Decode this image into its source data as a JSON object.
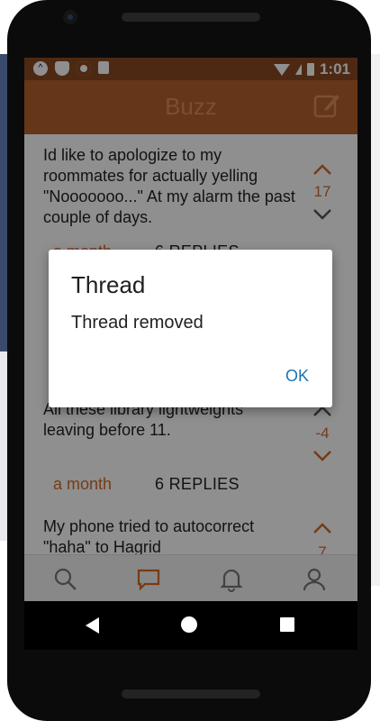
{
  "status_bar": {
    "time": "1:01",
    "icons": [
      "app-notification-icon",
      "shield-icon",
      "record-icon",
      "sd-card-icon",
      "wifi-icon",
      "signal-icon",
      "battery-icon"
    ]
  },
  "app_bar": {
    "title": "Buzz",
    "compose_icon": "compose-icon"
  },
  "posts": [
    {
      "text": "Id like to apologize to my roommates for actually yelling \"Nooooooo...\" At my alarm the past couple of days.",
      "votes": "17",
      "age": "a month",
      "replies": "6 REPLIES"
    },
    {
      "text": "All these library lightweights leaving before 11.",
      "votes": "-4",
      "age": "a month",
      "replies": "6 REPLIES"
    },
    {
      "text": "My phone tried to autocorrect \"haha\" to Hagrid",
      "votes": "7"
    }
  ],
  "bottom_nav": {
    "items": [
      "search-icon",
      "chat-icon",
      "bell-icon",
      "profile-icon"
    ]
  },
  "dialog": {
    "title": "Thread",
    "message": "Thread removed",
    "ok_label": "OK"
  },
  "colors": {
    "status_bar": "#8a4a22",
    "app_bar": "#b6602c",
    "accent": "#d26a2a",
    "dialog_button": "#1a73b5"
  }
}
